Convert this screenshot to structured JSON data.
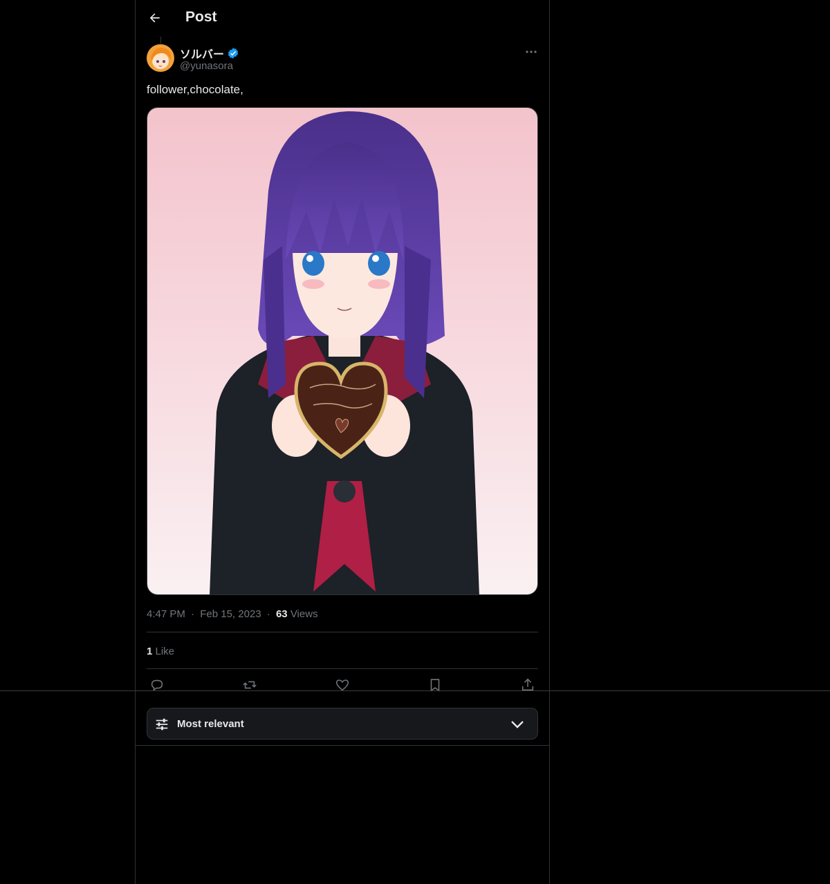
{
  "header": {
    "title": "Post"
  },
  "author": {
    "display_name": "ソルバー",
    "handle": "@yunasora"
  },
  "post": {
    "text": "follower,chocolate,"
  },
  "meta": {
    "time": "4:47 PM",
    "sep1": "·",
    "date": "Feb 15, 2023",
    "sep2": "·",
    "views_count": "63",
    "views_label": " Views"
  },
  "likes": {
    "count": "1",
    "label": " Like"
  },
  "sort": {
    "label": "Most relevant"
  },
  "colors": {
    "background": "#000000",
    "border": "#2f3336",
    "muted": "#71767b",
    "text": "#e7e9ea",
    "verified": "#1d9bf0"
  }
}
